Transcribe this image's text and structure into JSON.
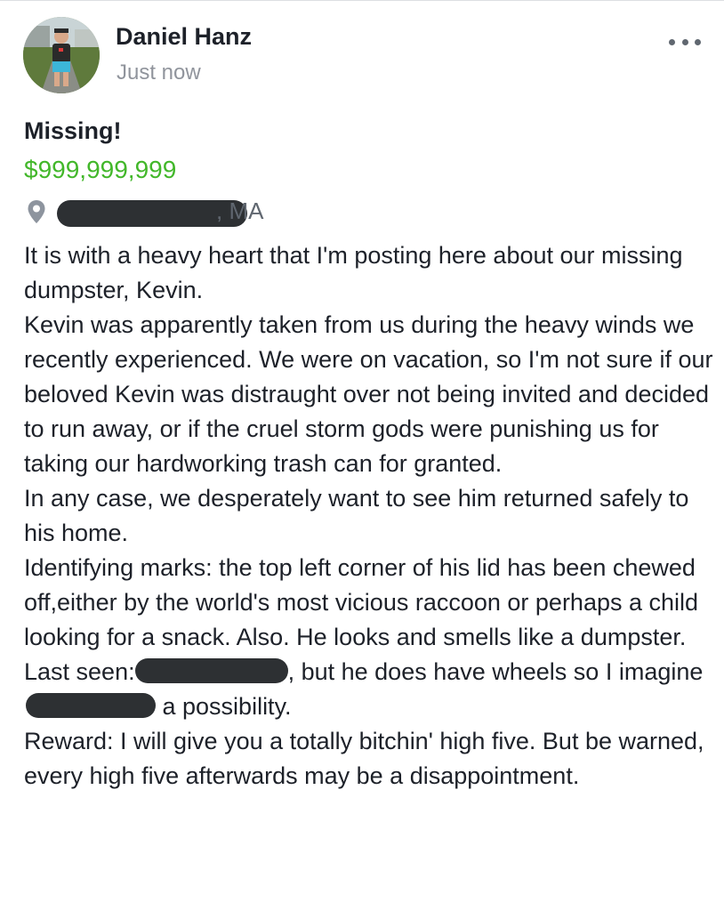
{
  "post": {
    "author_name": "Daniel Hanz",
    "timestamp": "Just now",
    "more_icon": "more-horizontal-icon",
    "listing": {
      "title": "Missing!",
      "price": "$999,999,999",
      "location_icon": "location-pin-icon",
      "location_suffix": ", MA"
    },
    "body": {
      "para1": "It is with a heavy heart that I'm posting here about our missing dumpster, Kevin.",
      "para2": "Kevin was apparently taken from us during the heavy winds we recently experienced. We were on vacation, so I'm not sure if our beloved Kevin was distraught over not being invited and decided to run away, or if the cruel storm gods were punishing us for taking our hardworking trash can for granted.",
      "para3": "In any case, we desperately want to see him returned safely to his home.",
      "para4": "Identifying marks: the top left corner of his lid has been chewed off,either by the world's most vicious raccoon or perhaps a child looking for a snack. Also. He looks and smells like a dumpster.",
      "last_seen_prefix": "Last seen:",
      "last_seen_suffix": ", but he does have wheels so I imagine",
      "last_seen_end": " a possibility.",
      "reward": "Reward: I will give you a totally bitchin' high five. But be warned, every high five afterwards may be a disappointment."
    }
  },
  "colors": {
    "price_green": "#42b72a",
    "secondary_text": "#90949c",
    "redaction": "#2d3033"
  }
}
